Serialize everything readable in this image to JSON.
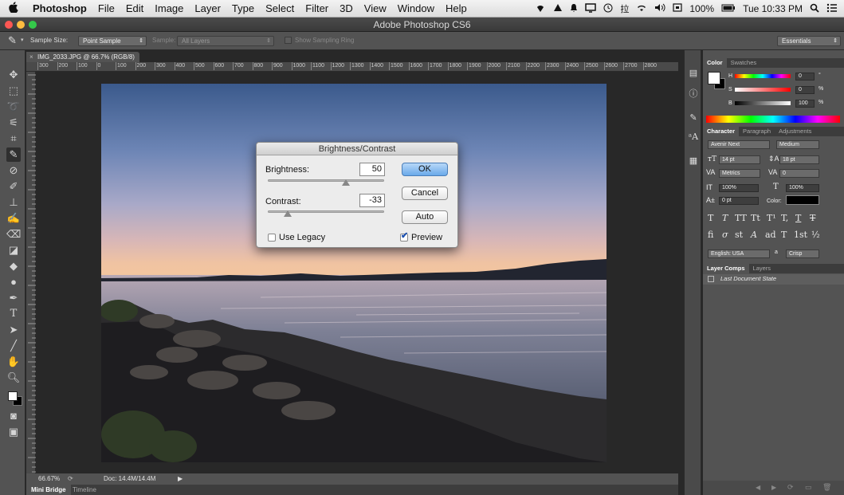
{
  "menubar": {
    "apple": "",
    "app": "Photoshop",
    "items": [
      "File",
      "Edit",
      "Image",
      "Layer",
      "Type",
      "Select",
      "Filter",
      "3D",
      "View",
      "Window",
      "Help"
    ],
    "battery": "100%",
    "clock": "Tue 10:33 PM"
  },
  "window": {
    "title": "Adobe Photoshop CS6"
  },
  "options": {
    "sample_size_label": "Sample Size:",
    "sample_size_value": "Point Sample",
    "sample_label": "Sample:",
    "sample_value": "All Layers",
    "show_ring_label": "Show Sampling Ring",
    "workspace": "Essentials"
  },
  "document": {
    "tab_title": "IMG_2033.JPG @ 66.7% (RGB/8)",
    "zoom": "66.67%",
    "doc_size": "Doc: 14.4M/14.4M",
    "ruler_top": [
      "300",
      "200",
      "100",
      "0",
      "100",
      "200",
      "300",
      "400",
      "500",
      "600",
      "700",
      "800",
      "900",
      "1000",
      "1100",
      "1200",
      "1300",
      "1400",
      "1500",
      "1600",
      "1700",
      "1800",
      "1900",
      "2000",
      "2100",
      "2200",
      "2300",
      "2400",
      "2500",
      "2600",
      "2700",
      "2800"
    ]
  },
  "bottom_tabs": [
    "Mini Bridge",
    "Timeline"
  ],
  "dialog": {
    "title": "Brightness/Contrast",
    "brightness_label": "Brightness:",
    "brightness_value": "50",
    "contrast_label": "Contrast:",
    "contrast_value": "-33",
    "ok": "OK",
    "cancel": "Cancel",
    "auto": "Auto",
    "use_legacy": "Use Legacy",
    "use_legacy_checked": false,
    "preview": "Preview",
    "preview_checked": true,
    "brightness_fraction": 0.67,
    "contrast_fraction": 0.17
  },
  "color_panel": {
    "tabs": [
      "Color",
      "Swatches"
    ],
    "h_label": "H",
    "h_value": "0",
    "h_unit": "°",
    "s_label": "S",
    "s_value": "0",
    "s_unit": "%",
    "b_label": "B",
    "b_value": "100",
    "b_unit": "%"
  },
  "character_panel": {
    "tabs": [
      "Character",
      "Paragraph",
      "Adjustments"
    ],
    "font_family": "Avenir Next",
    "font_style": "Medium",
    "font_size": "14 pt",
    "leading": "18 pt",
    "kerning": "Metrics",
    "tracking": "0",
    "vscale": "100%",
    "hscale": "100%",
    "baseline": "0 pt",
    "color_label": "Color:",
    "language": "English: USA",
    "aa_label": "a",
    "antialias": "Crisp",
    "glyphs_row1": [
      "T",
      "T",
      "TT",
      "Tt",
      "T¹",
      "T,",
      "T",
      "T"
    ],
    "glyphs_row2": [
      "fi",
      "σ",
      "st",
      "A",
      "ad",
      "T",
      "1st",
      "½"
    ]
  },
  "layercomps_panel": {
    "tabs": [
      "Layer Comps",
      "Layers"
    ],
    "item": "Last Document State"
  },
  "colors": {
    "ui_dark": "#282828",
    "panel": "#535353",
    "accent": "#4a90e2"
  }
}
